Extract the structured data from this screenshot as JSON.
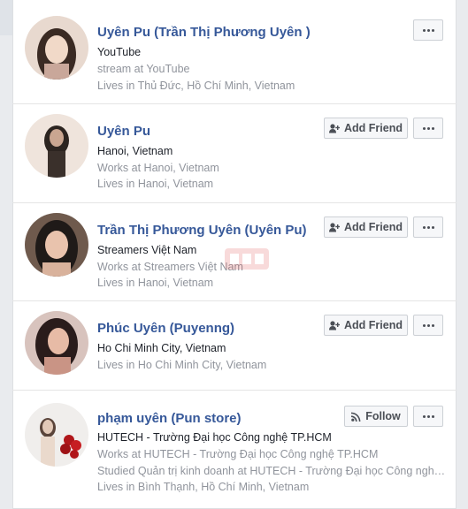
{
  "results": [
    {
      "name": "Uyên Pu (Trần Thị Phương Uyên )",
      "lines": [
        "YouTube",
        "stream at YouTube",
        "Lives in Thủ Đức, Hồ Chí Minh, Vietnam"
      ],
      "action": null,
      "avatar_colors": [
        "#e8d9cf",
        "#3a2a23",
        "#f1d9c8"
      ]
    },
    {
      "name": "Uyên Pu",
      "lines": [
        "Hanoi, Vietnam",
        "Works at Hanoi, Vietnam",
        "Lives in Hanoi, Vietnam"
      ],
      "action": "Add Friend",
      "avatar_colors": [
        "#efe4dc",
        "#2c2420",
        "#caa691"
      ]
    },
    {
      "name": "Trần Thị Phương Uyên (Uyên Pu)",
      "lines": [
        "Streamers Việt Nam",
        "Works at Streamers Việt Nam",
        "Lives in Hanoi, Vietnam"
      ],
      "action": "Add Friend",
      "avatar_colors": [
        "#6f5a4d",
        "#1f1a18",
        "#e9c3ad"
      ]
    },
    {
      "name": "Phúc Uyên (Puyenng)",
      "lines": [
        "Ho Chi Minh City, Vietnam",
        "Lives in Ho Chi Minh City, Vietnam"
      ],
      "action": "Add Friend",
      "avatar_colors": [
        "#d8c3bd",
        "#2a1c1b",
        "#e7bba6"
      ]
    },
    {
      "name": "phạm uyên (Pun store)",
      "lines": [
        "HUTECH - Trường Đại học Công nghệ TP.HCM",
        "Works at HUTECH - Trường Đại học Công nghệ TP.HCM",
        "Studied Quản trị kinh doanh at HUTECH - Trường Đại học Công nghệ TP.HCM",
        "Lives in Bình Thạnh, Hồ Chí Minh, Vietnam"
      ],
      "action": "Follow",
      "avatar_colors": [
        "#f0eeec",
        "#b0161a",
        "#e2c9b8"
      ]
    }
  ],
  "colors": {
    "link": "#365899",
    "meta": "#90949c",
    "text": "#1d2129",
    "background": "#e9ebee"
  }
}
